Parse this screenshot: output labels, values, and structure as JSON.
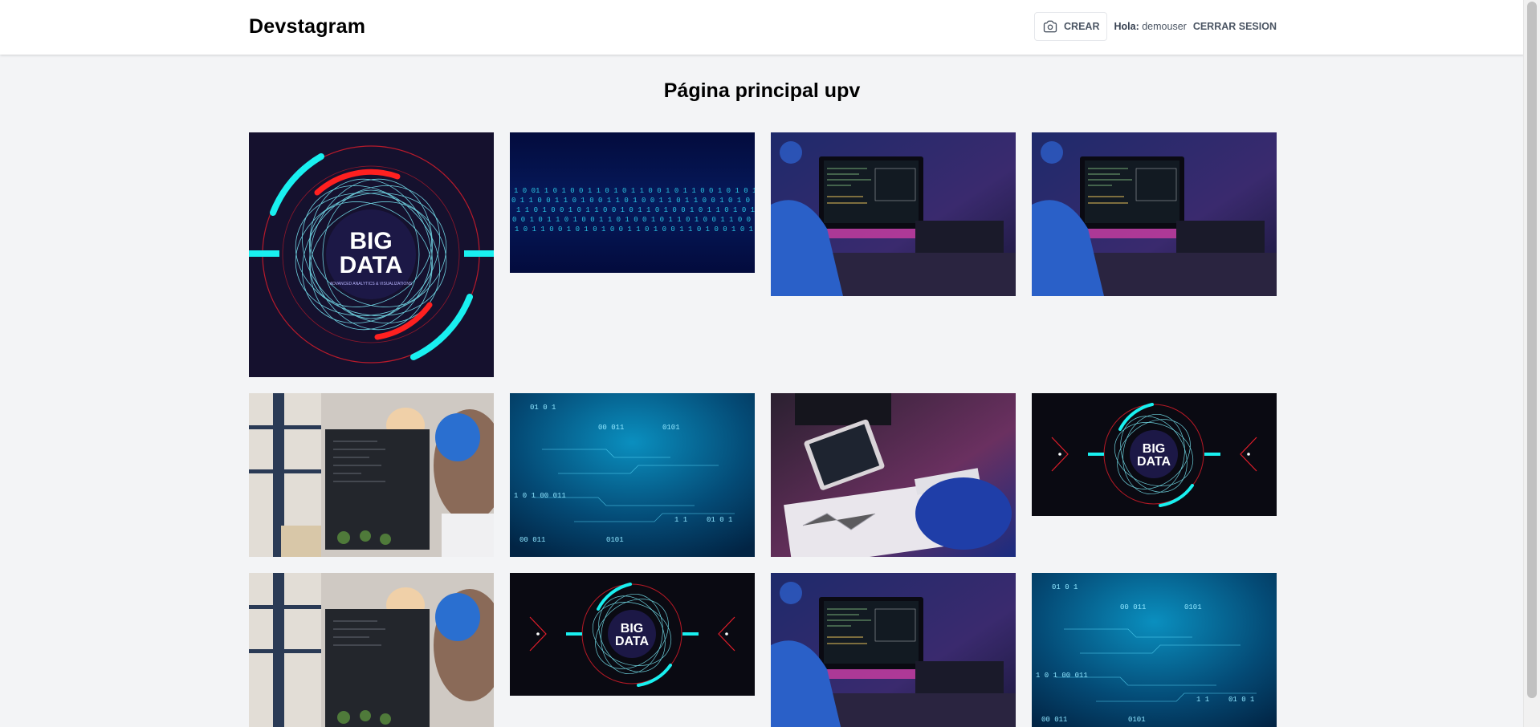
{
  "header": {
    "brand": "Devstagram",
    "create_label": "CREAR",
    "greeting_prefix": "Hola:",
    "username": "demouser",
    "logout_label": "CERRAR SESION"
  },
  "page_title": "Página principal upv",
  "posts": [
    {
      "kind": "bigdata-square",
      "text1": "BIG",
      "text2": "DATA",
      "caption": "ADVANCED ANALYTICS & VISUALIZATIONS"
    },
    {
      "kind": "binary"
    },
    {
      "kind": "desk-night"
    },
    {
      "kind": "desk-night"
    },
    {
      "kind": "coder-beard"
    },
    {
      "kind": "circuit",
      "digits": [
        "01 0 1",
        "00 011",
        "0101",
        "1 0 1 00 011",
        "01 0 1",
        "1 1",
        "00 011",
        "0101"
      ]
    },
    {
      "kind": "tablet-coder"
    },
    {
      "kind": "bigdata-wide",
      "text1": "BIG",
      "text2": "DATA"
    },
    {
      "kind": "coder-beard"
    },
    {
      "kind": "bigdata-wide",
      "text1": "BIG",
      "text2": "DATA"
    },
    {
      "kind": "desk-night"
    },
    {
      "kind": "circuit",
      "digits": [
        "01 0 1",
        "00 011",
        "0101",
        "1 0 1 00 011",
        "01 0 1",
        "1 1",
        "00 011",
        "0101"
      ]
    }
  ]
}
